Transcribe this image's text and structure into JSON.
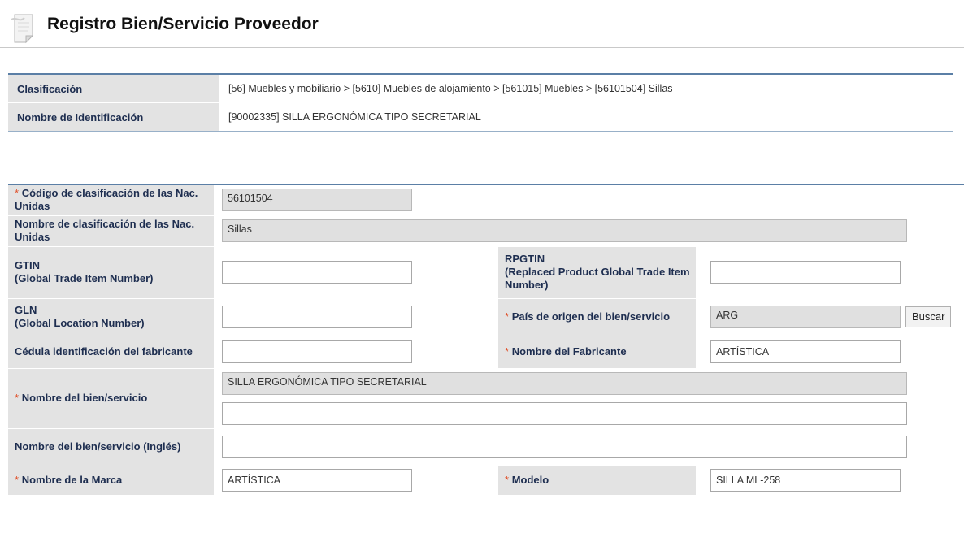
{
  "header": {
    "title": "Registro Bien/Servicio Proveedor",
    "icon": "note-icon"
  },
  "classification": {
    "label": "Clasificación",
    "path": "[56] Muebles y mobiliario  >  [5610] Muebles de alojamiento  >  [561015] Muebles  >  [56101504] Sillas",
    "id_label": "Nombre de Identificación",
    "id_value": "[90002335] SILLA ERGONÓMICA TIPO SECRETARIAL"
  },
  "form": {
    "required_mark": "*",
    "un_code_label": "Código de clasificación de las Nac. Unidas",
    "un_code_value": "56101504",
    "un_name_label": "Nombre de clasificación de las Nac. Unidas",
    "un_name_value": "Sillas",
    "gtin_label_1": "GTIN",
    "gtin_label_2": "(Global Trade Item Number)",
    "gtin_value": "",
    "rpgtin_label_1": "RPGTIN",
    "rpgtin_label_2": "(Replaced Product Global Trade Item Number)",
    "rpgtin_value": "",
    "gln_label_1": "GLN",
    "gln_label_2": "(Global Location Number)",
    "gln_value": "",
    "country_label": "País de origen del bien/servicio",
    "country_value": "ARG",
    "search_button": "Buscar",
    "cedula_label": "Cédula identificación del fabricante",
    "cedula_value": "",
    "manufacturer_label": "Nombre del Fabricante",
    "manufacturer_value": "ARTÍSTICA",
    "product_name_label": "Nombre del bien/servicio",
    "product_name_value": "SILLA ERGONÓMICA TIPO SECRETARIAL",
    "product_name_extra_value": "",
    "product_name_en_label": "Nombre del bien/servicio (Inglés)",
    "product_name_en_value": "",
    "brand_label": "Nombre de la Marca",
    "brand_value": "ARTÍSTICA",
    "model_label": "Modelo",
    "model_value": "SILLA ML-258"
  }
}
